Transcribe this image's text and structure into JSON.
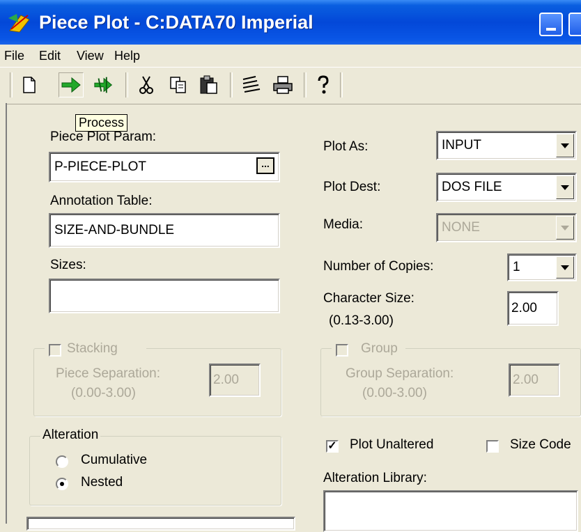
{
  "window": {
    "title": "Piece Plot - C:DATA70  Imperial"
  },
  "menu": [
    "File",
    "Edit",
    "View",
    "Help"
  ],
  "toolbar": {
    "items": [
      "new-icon",
      "process-icon",
      "process-all-icon",
      "cut-icon",
      "copy-icon",
      "paste-icon",
      "properties-icon",
      "print-icon",
      "help-icon"
    ],
    "tooltip": "Process"
  },
  "left": {
    "piece_plot_param_label": "Piece Plot Param:",
    "piece_plot_param_value": "P-PIECE-PLOT",
    "browse_label": "...",
    "annotation_table_label": "Annotation Table:",
    "annotation_table_value": "SIZE-AND-BUNDLE",
    "sizes_label": "Sizes:",
    "sizes_value": "",
    "stacking_label": "Stacking",
    "piece_separation_label": "Piece Separation:",
    "piece_separation_range": "(0.00-3.00)",
    "piece_separation_value": "2.00",
    "alteration_label": "Alteration",
    "cumulative_label": "Cumulative",
    "nested_label": "Nested",
    "alteration_selected": "Nested"
  },
  "right": {
    "plot_as_label": "Plot As:",
    "plot_as_value": "INPUT",
    "plot_dest_label": "Plot Dest:",
    "plot_dest_value": "DOS FILE",
    "media_label": "Media:",
    "media_value": "NONE",
    "copies_label": "Number of Copies:",
    "copies_value": "1",
    "char_size_label": "Character Size:",
    "char_size_range": "(0.13-3.00)",
    "char_size_value": "2.00",
    "group_label": "Group",
    "group_separation_label": "Group Separation:",
    "group_separation_range": "(0.00-3.00)",
    "group_separation_value": "2.00",
    "plot_unaltered_label": "Plot Unaltered",
    "plot_unaltered_checked": true,
    "size_code_label": "Size Code",
    "size_code_checked": false,
    "alteration_library_label": "Alteration Library:",
    "alteration_library_value": ""
  }
}
